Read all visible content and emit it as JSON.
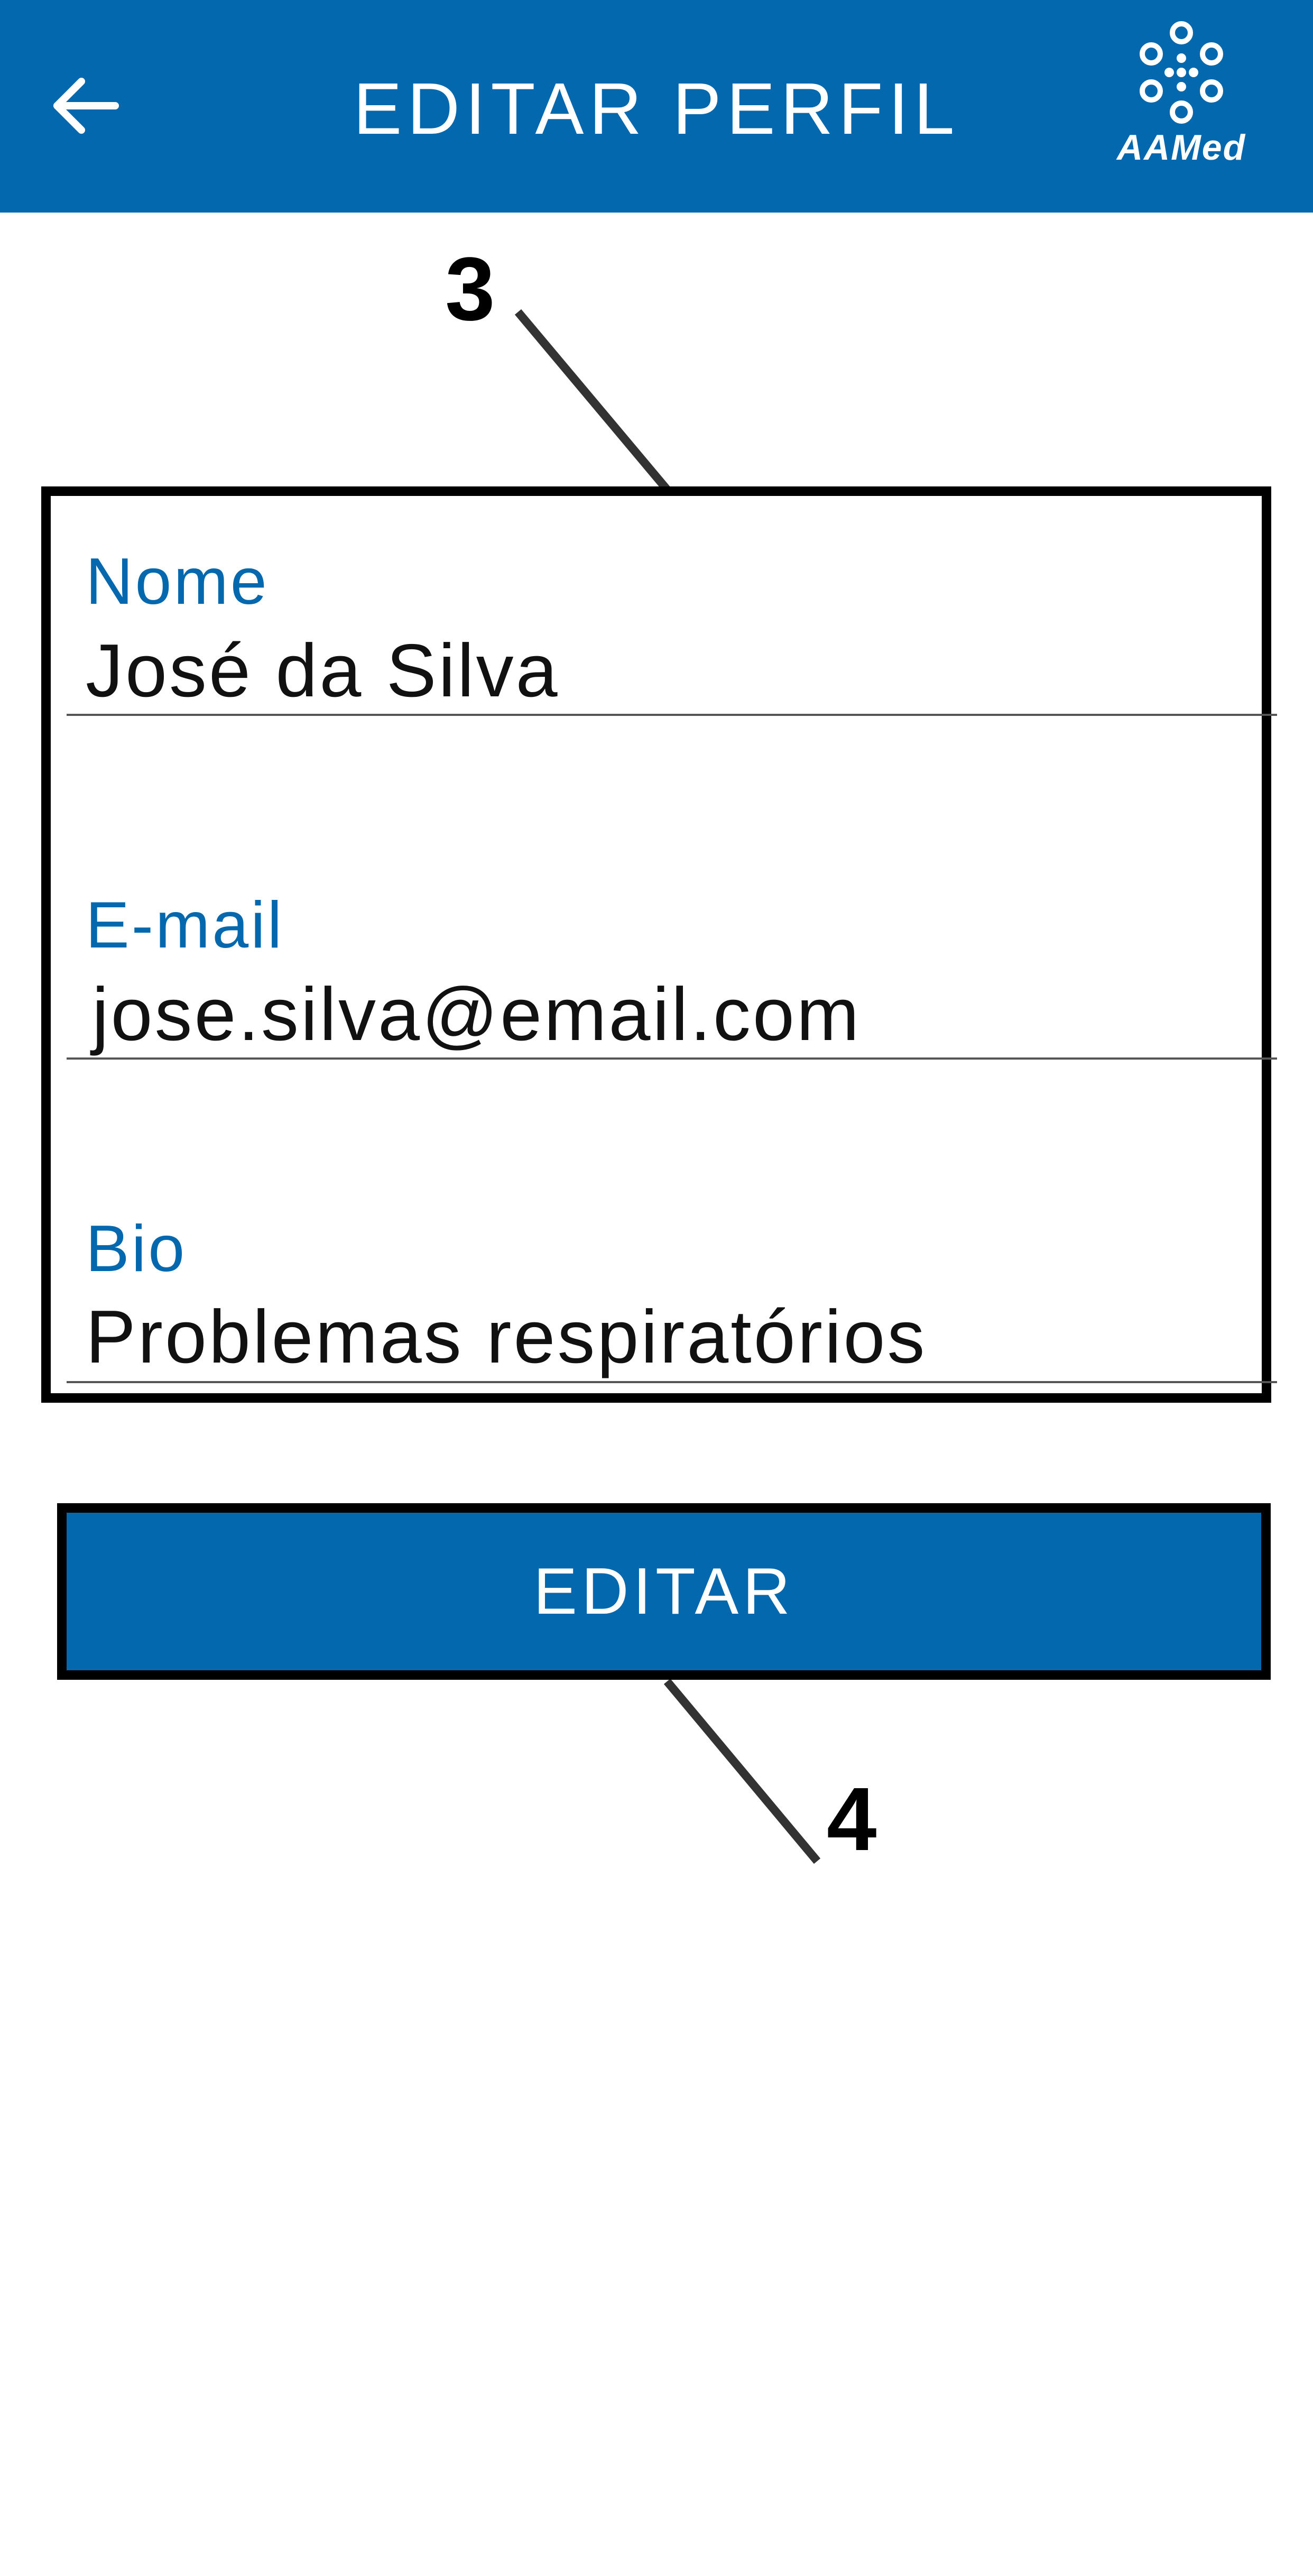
{
  "colors": {
    "primary": "#0468ae",
    "annotation": "#000000",
    "label": "#0468ae",
    "text": "#111111"
  },
  "header": {
    "back_icon": "arrow-left-icon",
    "title": "EDITAR PERFIL",
    "logo_icon": "aamed-dots-logo",
    "logo_text": "AAMed"
  },
  "annotations": {
    "form_callout": "3",
    "button_callout": "4"
  },
  "form": {
    "fields": [
      {
        "label": "Nome",
        "value": "José da Silva"
      },
      {
        "label": "E-mail",
        "value": "jose.silva@email.com"
      },
      {
        "label": "Bio",
        "value": "Problemas respiratórios"
      }
    ]
  },
  "actions": {
    "edit_label": "EDITAR"
  }
}
